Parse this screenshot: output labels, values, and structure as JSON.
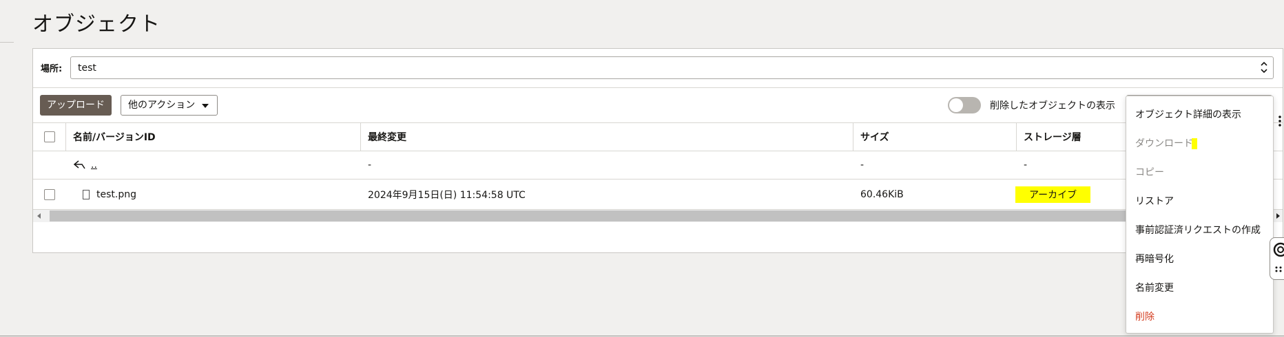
{
  "page": {
    "title": "オブジェクト"
  },
  "location": {
    "label": "場所:",
    "value": "test"
  },
  "toolbar": {
    "upload_label": "アップロード",
    "more_actions_label": "他のアクション",
    "show_deleted_label": "削除したオブジェクトの表示",
    "show_deleted_on": false
  },
  "table": {
    "columns": [
      "名前/バージョンID",
      "最終変更",
      "サイズ",
      "ストレージ層"
    ],
    "rows": [
      {
        "name": "..",
        "modified": "-",
        "size": "-",
        "tier": "-"
      },
      {
        "name": "test.png",
        "modified": "2024年9月15日(日) 11:54:58 UTC",
        "size": "60.46KiB",
        "tier": "アーカイブ"
      }
    ]
  },
  "context_menu": {
    "items": [
      {
        "label": "オブジェクト詳細の表示",
        "state": "enabled"
      },
      {
        "label": "ダウンロード",
        "state": "disabled"
      },
      {
        "label": "コピー",
        "state": "disabled"
      },
      {
        "label": "リストア",
        "state": "enabled"
      },
      {
        "label": "事前認証済リクエストの作成",
        "state": "enabled"
      },
      {
        "label": "再暗号化",
        "state": "enabled"
      },
      {
        "label": "名前変更",
        "state": "enabled"
      },
      {
        "label": "削除",
        "state": "danger"
      }
    ]
  },
  "colors": {
    "highlight": "#ffff00",
    "primary_button": "#675c53",
    "danger": "#d43d20"
  }
}
